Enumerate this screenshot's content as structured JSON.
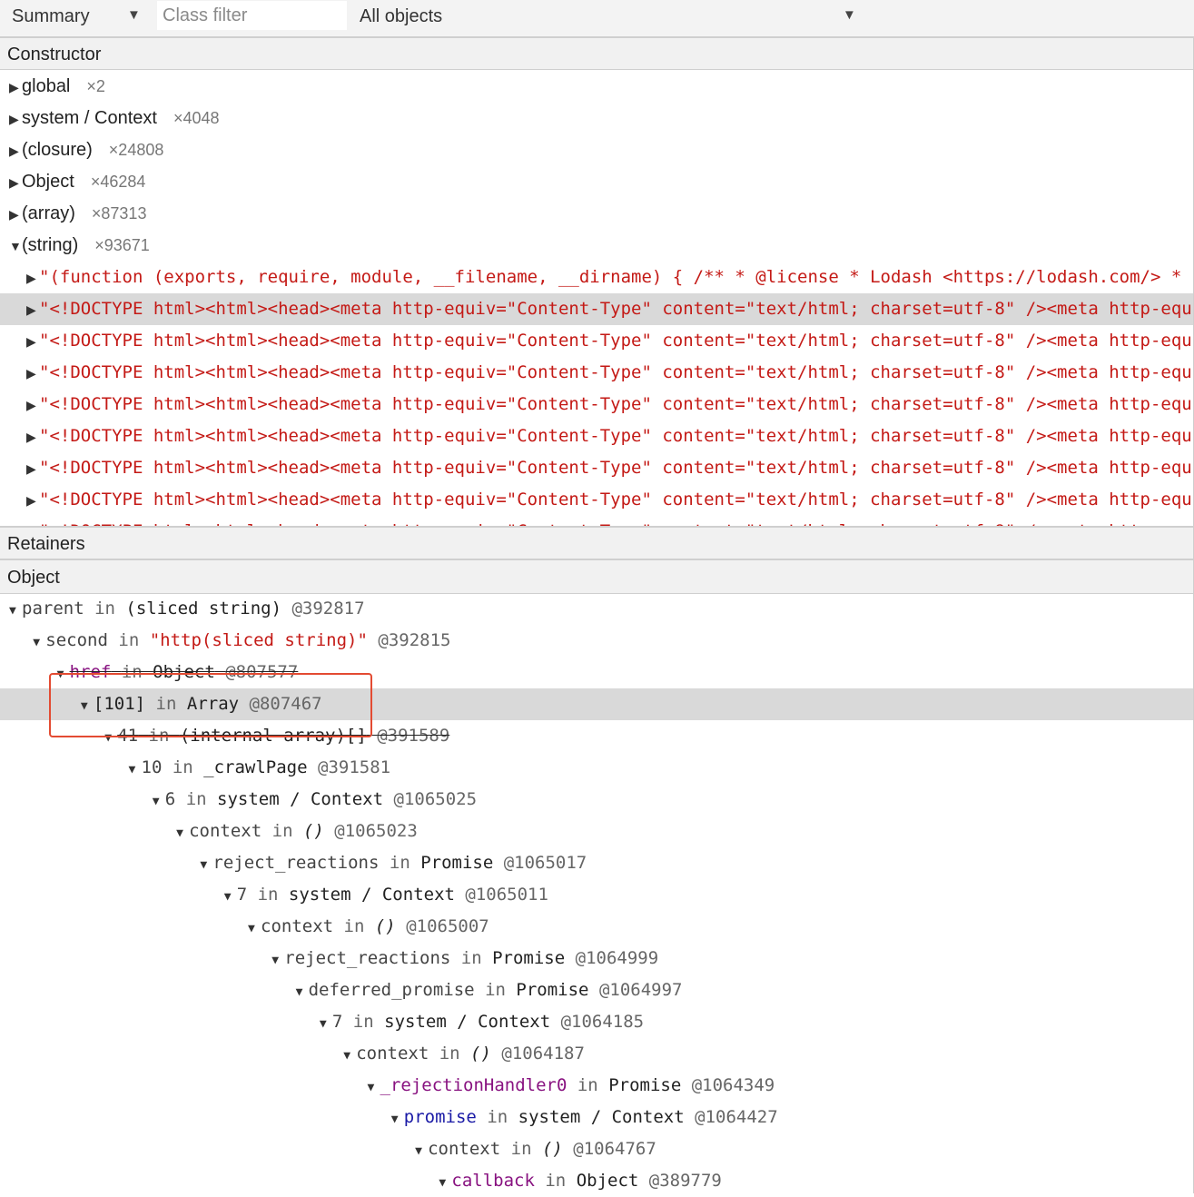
{
  "toolbar": {
    "view": "Summary",
    "class_filter_placeholder": "Class filter",
    "objects_filter": "All objects",
    "arrow": "▼"
  },
  "constructor_header": "Constructor",
  "constructors": [
    {
      "name": "global",
      "count": "×2",
      "expanded": false
    },
    {
      "name": "system / Context",
      "count": "×4048",
      "expanded": false
    },
    {
      "name": "(closure)",
      "count": "×24808",
      "expanded": false
    },
    {
      "name": "Object",
      "count": "×46284",
      "expanded": false
    },
    {
      "name": "(array)",
      "count": "×87313",
      "expanded": false
    },
    {
      "name": "(string)",
      "count": "×93671",
      "expanded": true
    }
  ],
  "string_rows": [
    "\"(function (exports, require, module, __filename, __dirname) { /** * @license * Lodash <https://lodash.com/> *",
    "\"<!DOCTYPE html><html><head><meta http-equiv=\"Content-Type\" content=\"text/html; charset=utf-8\" /><meta http-equ",
    "\"<!DOCTYPE html><html><head><meta http-equiv=\"Content-Type\" content=\"text/html; charset=utf-8\" /><meta http-equ",
    "\"<!DOCTYPE html><html><head><meta http-equiv=\"Content-Type\" content=\"text/html; charset=utf-8\" /><meta http-equ",
    "\"<!DOCTYPE html><html><head><meta http-equiv=\"Content-Type\" content=\"text/html; charset=utf-8\" /><meta http-equ",
    "\"<!DOCTYPE html><html><head><meta http-equiv=\"Content-Type\" content=\"text/html; charset=utf-8\" /><meta http-equ",
    "\"<!DOCTYPE html><html><head><meta http-equiv=\"Content-Type\" content=\"text/html; charset=utf-8\" /><meta http-equ",
    "\"<!DOCTYPE html><html><head><meta http-equiv=\"Content-Type\" content=\"text/html; charset=utf-8\" /><meta http-equ",
    "\"<!DOCTYPE html><html><head><meta http-equiv=\"Content-Type\" content=\"text/html; charset=utf-8\" /><meta http-equ"
  ],
  "selected_string_row": 1,
  "retainers_header": "Retainers",
  "object_header": "Object",
  "retainers": [
    {
      "prop": "parent",
      "prop_style": "plain",
      "target": "(sliced string)",
      "target_style": "plain",
      "id": "@392817"
    },
    {
      "prop": "second",
      "prop_style": "plain",
      "target": "\"http(sliced string)\"",
      "target_style": "str",
      "id": "@392815"
    },
    {
      "prop": "href",
      "prop_style": "purple",
      "target": "Object",
      "target_style": "plain",
      "id": "@807577"
    },
    {
      "prop": "[101]",
      "prop_style": "dark",
      "target": "Array",
      "target_style": "plain",
      "id": "@807467"
    },
    {
      "prop": "41",
      "prop_style": "plain",
      "target": "(internal array)[]",
      "target_style": "plain",
      "id": "@391589"
    },
    {
      "prop": "10",
      "prop_style": "plain",
      "target": "_crawlPage",
      "target_style": "plain",
      "id": "@391581"
    },
    {
      "prop": "6",
      "prop_style": "plain",
      "target": "system / Context",
      "target_style": "plain",
      "id": "@1065025"
    },
    {
      "prop": "context",
      "prop_style": "plain",
      "target": "()",
      "target_style": "ital",
      "id": "@1065023"
    },
    {
      "prop": "reject_reactions",
      "prop_style": "plain",
      "target": "Promise",
      "target_style": "plain",
      "id": "@1065017"
    },
    {
      "prop": "7",
      "prop_style": "plain",
      "target": "system / Context",
      "target_style": "plain",
      "id": "@1065011"
    },
    {
      "prop": "context",
      "prop_style": "plain",
      "target": "()",
      "target_style": "ital",
      "id": "@1065007"
    },
    {
      "prop": "reject_reactions",
      "prop_style": "plain",
      "target": "Promise",
      "target_style": "plain",
      "id": "@1064999"
    },
    {
      "prop": "deferred_promise",
      "prop_style": "plain",
      "target": "Promise",
      "target_style": "plain",
      "id": "@1064997"
    },
    {
      "prop": "7",
      "prop_style": "plain",
      "target": "system / Context",
      "target_style": "plain",
      "id": "@1064185"
    },
    {
      "prop": "context",
      "prop_style": "plain",
      "target": "()",
      "target_style": "ital",
      "id": "@1064187"
    },
    {
      "prop": "_rejectionHandler0",
      "prop_style": "purple",
      "target": "Promise",
      "target_style": "plain",
      "id": "@1064349"
    },
    {
      "prop": "promise",
      "prop_style": "blue",
      "target": "system / Context",
      "target_style": "plain",
      "id": "@1064427"
    },
    {
      "prop": "context",
      "prop_style": "plain",
      "target": "()",
      "target_style": "ital",
      "id": "@1064767"
    },
    {
      "prop": "callback",
      "prop_style": "purple",
      "target": "Object",
      "target_style": "plain",
      "id": "@389779"
    }
  ],
  "selected_retainer_row": 3,
  "in_word": "in",
  "colors": {
    "string": "#c41a16",
    "purple": "#881280",
    "blue": "#1a1aa6",
    "highlight": "#e34b32"
  }
}
